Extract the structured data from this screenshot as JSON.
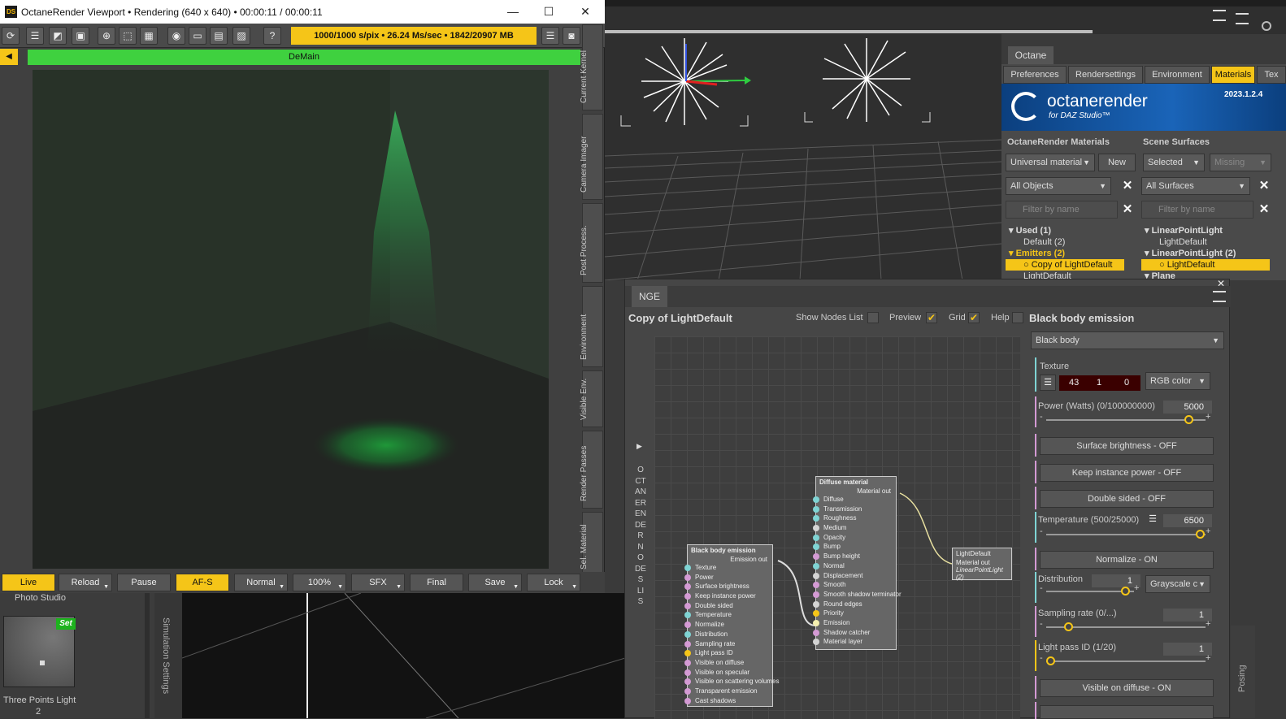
{
  "viewport": {
    "title": "OctaneRender Viewport • Rendering (640 x 640) • 00:00:11 / 00:00:11",
    "app_badge": "DS",
    "stats": "1000/1000 s/pix • 26.24 Ms/sec • 1842/20907 MB",
    "kernel_bar": "DeMain",
    "side_tabs": [
      "Current Kernel",
      "Camera Imager",
      "Post Process.",
      "Environment",
      "Visible Env.",
      "Render Passes",
      "Sel. Material"
    ],
    "bottom_buttons": [
      {
        "label": "Live",
        "active": true
      },
      {
        "label": "Reload"
      },
      {
        "label": "Pause"
      },
      {
        "label": "AF-S",
        "active": true
      },
      {
        "label": "Normal"
      },
      {
        "label": "100%"
      },
      {
        "label": "SFX"
      },
      {
        "label": "Final"
      },
      {
        "label": "Save"
      },
      {
        "label": "Lock"
      }
    ],
    "help": "?"
  },
  "photo_studio": {
    "title": "Photo Studio",
    "set_label": "Set",
    "preset": "Three Points Light",
    "preset_suffix": "2"
  },
  "simulation": {
    "label": "Simulation Settings"
  },
  "octane_panel": {
    "title": "Octane",
    "tabs": [
      "Preferences",
      "Rendersettings",
      "Environment",
      "Materials",
      "Tex"
    ],
    "active_tab": "Materials",
    "banner": {
      "brand": "octanerender",
      "sub": "for DAZ Studio™",
      "version": "2023.1.2.4"
    },
    "left": {
      "header": "OctaneRender Materials",
      "type_dropdown": "Universal material",
      "new_button": "New",
      "scope_dropdown": "All Objects",
      "filter_placeholder": "Filter by name",
      "tree": [
        {
          "text": "Used (1)",
          "style": "b"
        },
        {
          "text": "Default (2)",
          "style": ""
        },
        {
          "text": "Emitters (2)",
          "style": "y"
        },
        {
          "text": "Copy of LightDefault",
          "style": "sel"
        },
        {
          "text": "LightDefault",
          "style": ""
        }
      ]
    },
    "right": {
      "header": "Scene Surfaces",
      "selected_dropdown": "Selected",
      "missing_dropdown": "Missing",
      "scope_dropdown": "All Surfaces",
      "filter_placeholder": "Filter by name",
      "tree": [
        {
          "text": "LinearPointLight",
          "style": "b"
        },
        {
          "text": "LightDefault",
          "style": ""
        },
        {
          "text": "LinearPointLight (2)",
          "style": "b"
        },
        {
          "text": "LightDefault",
          "style": "sel"
        },
        {
          "text": "Plane",
          "style": "b"
        }
      ]
    }
  },
  "nge": {
    "tab": "NGE",
    "material_name": "Copy of LightDefault",
    "show_nodes_list": "Show Nodes List",
    "preview": "Preview",
    "grid": "Grid",
    "help": "Help",
    "sidebar_text": "OCTANERENDER NODES LIS",
    "nodes": {
      "blackbody": {
        "title": "Black body emission",
        "out": "Emission out",
        "pins": [
          {
            "name": "Texture",
            "color": "#7fd4d4"
          },
          {
            "name": "Power",
            "color": "#d49ad4"
          },
          {
            "name": "Surface brightness",
            "color": "#d49ad4"
          },
          {
            "name": "Keep instance power",
            "color": "#d49ad4"
          },
          {
            "name": "Double sided",
            "color": "#d49ad4"
          },
          {
            "name": "Temperature",
            "color": "#7fd4d4"
          },
          {
            "name": "Normalize",
            "color": "#d49ad4"
          },
          {
            "name": "Distribution",
            "color": "#7fd4d4"
          },
          {
            "name": "Sampling rate",
            "color": "#d49ad4"
          },
          {
            "name": "Light pass ID",
            "color": "#f5c518"
          },
          {
            "name": "Visible on diffuse",
            "color": "#d49ad4"
          },
          {
            "name": "Visible on specular",
            "color": "#d49ad4"
          },
          {
            "name": "Visible on scattering volumes",
            "color": "#d49ad4"
          },
          {
            "name": "Transparent emission",
            "color": "#d49ad4"
          },
          {
            "name": "Cast shadows",
            "color": "#d49ad4"
          }
        ]
      },
      "diffuse": {
        "title": "Diffuse material",
        "out": "Material out",
        "pins": [
          {
            "name": "Diffuse",
            "color": "#7fd4d4"
          },
          {
            "name": "Transmission",
            "color": "#7fd4d4"
          },
          {
            "name": "Roughness",
            "color": "#7fd4d4"
          },
          {
            "name": "Medium",
            "color": "#d4d4d4"
          },
          {
            "name": "Opacity",
            "color": "#7fd4d4"
          },
          {
            "name": "Bump",
            "color": "#7fd4d4"
          },
          {
            "name": "Bump height",
            "color": "#d49ad4"
          },
          {
            "name": "Normal",
            "color": "#7fd4d4"
          },
          {
            "name": "Displacement",
            "color": "#d4d4d4"
          },
          {
            "name": "Smooth",
            "color": "#d49ad4"
          },
          {
            "name": "Smooth shadow terminator",
            "color": "#d49ad4"
          },
          {
            "name": "Round edges",
            "color": "#d4d4d4"
          },
          {
            "name": "Priority",
            "color": "#f5c518"
          },
          {
            "name": "Emission",
            "color": "#f5f0b0"
          },
          {
            "name": "Shadow catcher",
            "color": "#d49ad4"
          },
          {
            "name": "Material layer",
            "color": "#d4d4d4"
          }
        ]
      },
      "output": {
        "title": "LightDefault",
        "line1": "Material out",
        "line2": "LinearPointLight (2)"
      }
    },
    "props": {
      "title": "Black body emission",
      "type_dropdown": "Black body",
      "texture_label": "Texture",
      "rgb": [
        "43",
        "1",
        "0"
      ],
      "rgb_mode": "RGB color",
      "power_label": "Power (Watts) (0/100000000)",
      "power_value": "5000",
      "power_fraction": 0.9,
      "surface_brightness": "Surface brightness - OFF",
      "keep_instance_power": "Keep instance power - OFF",
      "double_sided": "Double sided - OFF",
      "temperature_label": "Temperature (500/25000)",
      "temperature_value": "6500",
      "temperature_fraction": 0.97,
      "normalize": "Normalize - ON",
      "distribution_label": "Distribution",
      "distribution_value": "1",
      "distribution_mode": "Grayscale c",
      "sampling_label": "Sampling rate (0/...)",
      "sampling_value": "1",
      "lightpass_label": "Light pass ID (1/20)",
      "lightpass_value": "1",
      "visible_diffuse": "Visible on diffuse - ON",
      "minus": "-",
      "plus": "+"
    }
  },
  "posing": {
    "label": "Posing"
  }
}
